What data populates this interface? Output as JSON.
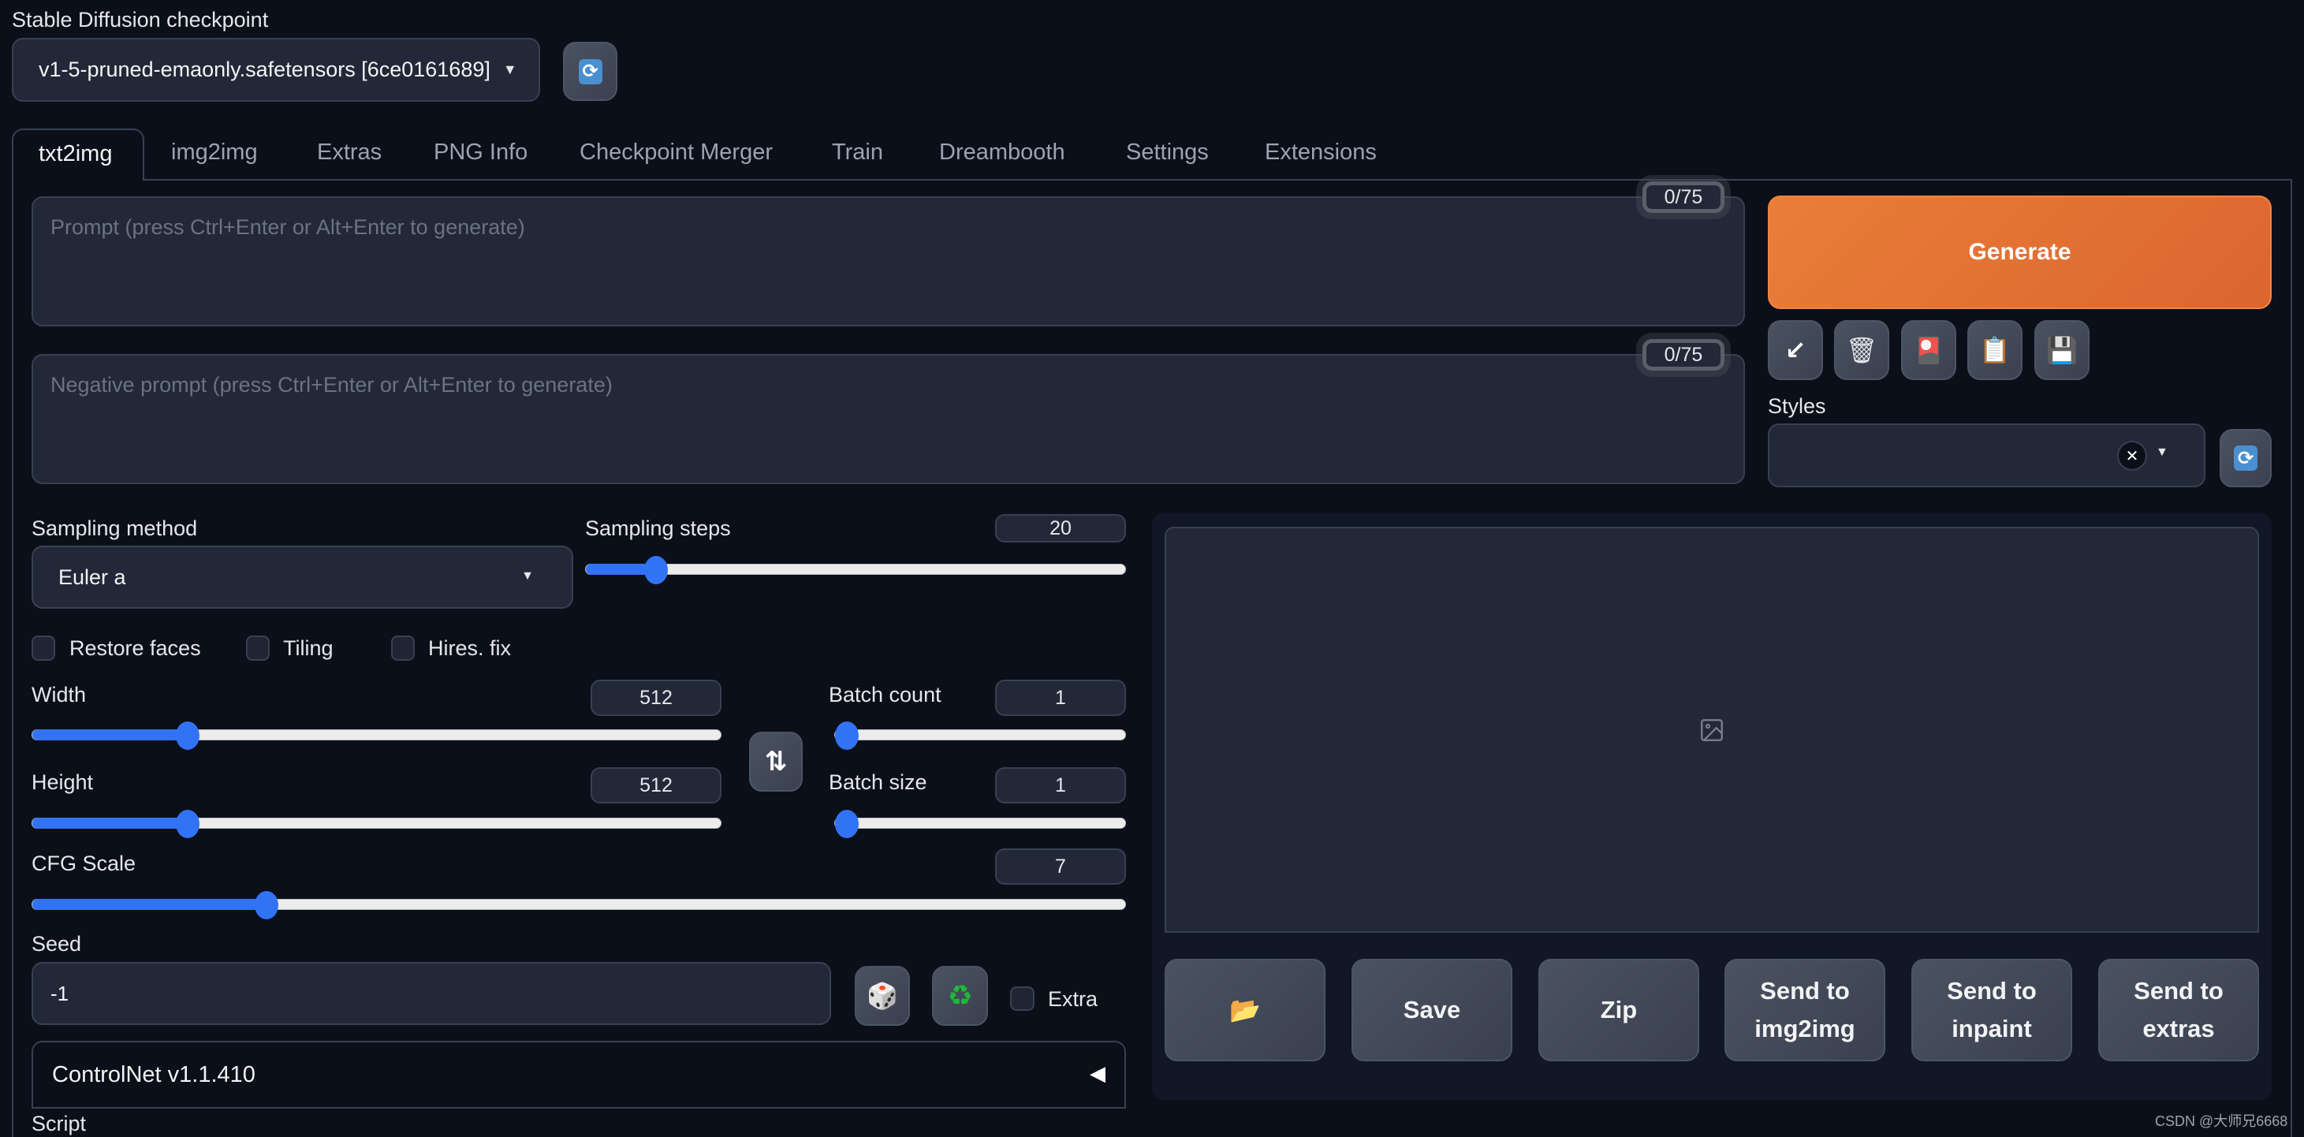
{
  "checkpoint": {
    "label": "Stable Diffusion checkpoint",
    "value": "v1-5-pruned-emaonly.safetensors [6ce0161689]",
    "refresh_icon": "refresh-icon"
  },
  "tabs": [
    {
      "label": "txt2img",
      "active": true
    },
    {
      "label": "img2img",
      "active": false
    },
    {
      "label": "Extras",
      "active": false
    },
    {
      "label": "PNG Info",
      "active": false
    },
    {
      "label": "Checkpoint Merger",
      "active": false
    },
    {
      "label": "Train",
      "active": false
    },
    {
      "label": "Dreambooth",
      "active": false
    },
    {
      "label": "Settings",
      "active": false
    },
    {
      "label": "Extensions",
      "active": false
    }
  ],
  "prompt": {
    "placeholder": "Prompt (press Ctrl+Enter or Alt+Enter to generate)",
    "value": "",
    "token_counter": "0/75"
  },
  "negative_prompt": {
    "placeholder": "Negative prompt (press Ctrl+Enter or Alt+Enter to generate)",
    "value": "",
    "token_counter": "0/75"
  },
  "generate": {
    "label": "Generate",
    "color": "#e8773a"
  },
  "tool_buttons": [
    {
      "icon": "arrow-down-left-icon",
      "glyph": "↙"
    },
    {
      "icon": "trash-icon",
      "glyph": "🗑"
    },
    {
      "icon": "styles-card-icon",
      "glyph": "🎴"
    },
    {
      "icon": "clipboard-icon",
      "glyph": "📋"
    },
    {
      "icon": "save-floppy-icon",
      "glyph": "💾"
    }
  ],
  "styles": {
    "label": "Styles",
    "value": "",
    "clear_glyph": "✕"
  },
  "sampling_method": {
    "label": "Sampling method",
    "value": "Euler a"
  },
  "sampling_steps": {
    "label": "Sampling steps",
    "value": "20",
    "fraction": 0.13
  },
  "checkboxes": [
    {
      "label": "Restore faces",
      "checked": false
    },
    {
      "label": "Tiling",
      "checked": false
    },
    {
      "label": "Hires. fix",
      "checked": false
    }
  ],
  "width": {
    "label": "Width",
    "value": "512",
    "fraction": 0.2258
  },
  "height": {
    "label": "Height",
    "value": "512",
    "fraction": 0.2258
  },
  "swap_glyph": "⇅",
  "batch_count": {
    "label": "Batch count",
    "value": "1",
    "fraction": 0.0
  },
  "batch_size": {
    "label": "Batch size",
    "value": "1",
    "fraction": 0.0
  },
  "cfg_scale": {
    "label": "CFG Scale",
    "value": "7",
    "fraction": 0.2143
  },
  "seed": {
    "label": "Seed",
    "value": "-1",
    "dice_glyph": "🎲",
    "recycle_glyph": "♻",
    "extra_label": "Extra"
  },
  "controlnet": {
    "label": "ControlNet v1.1.410",
    "toggle_glyph": "◀"
  },
  "script": {
    "label": "Script"
  },
  "output": {
    "image_placeholder_icon": "image-icon",
    "buttons": [
      {
        "label": "",
        "icon": "folder-icon",
        "glyph": "📂"
      },
      {
        "label": "Save"
      },
      {
        "label": "Zip"
      },
      {
        "label": "Send to img2img"
      },
      {
        "label": "Send to inpaint"
      },
      {
        "label": "Send to extras"
      }
    ]
  },
  "watermark": "CSDN @大师兄6668"
}
